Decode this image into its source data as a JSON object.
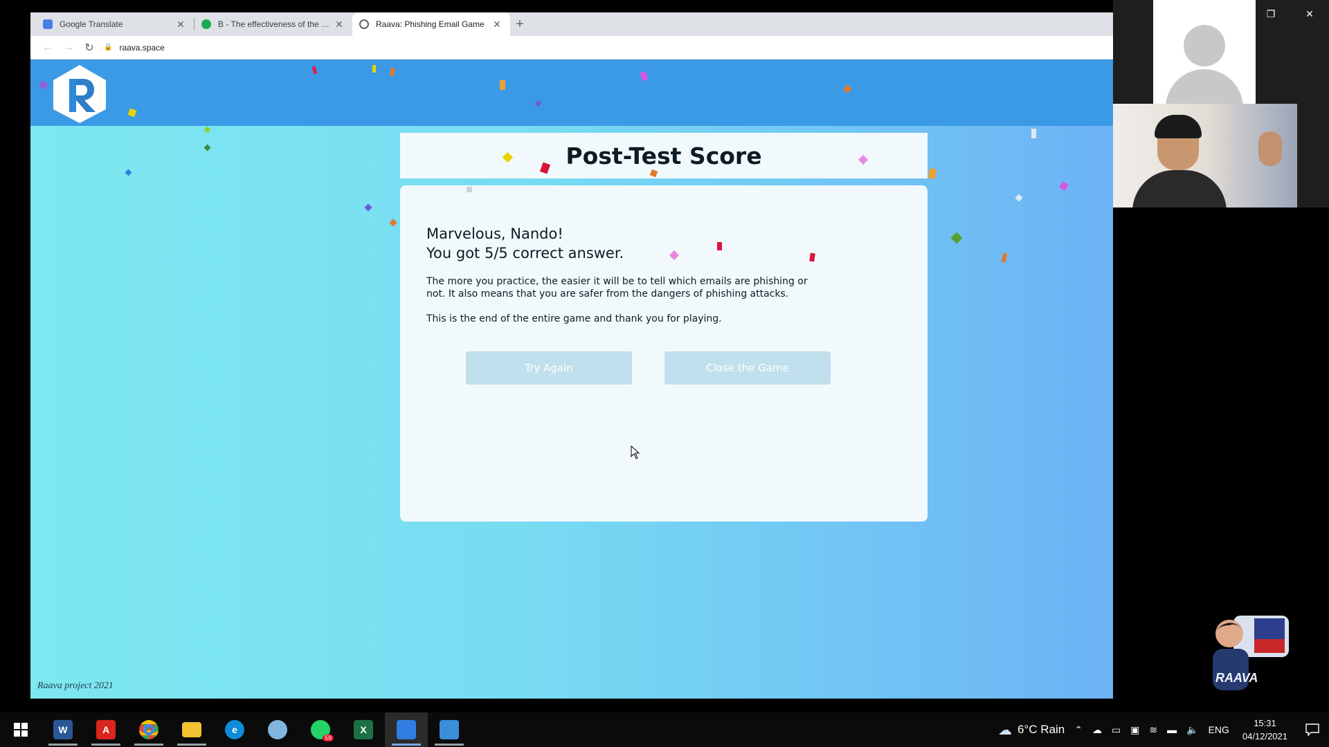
{
  "browser": {
    "tabs": [
      {
        "title": "Google Translate",
        "favicon_color": "#4a7de8"
      },
      {
        "title": "B - The effectiveness of the Phishi",
        "favicon_color": "#1eaa55"
      },
      {
        "title": "Raava: Phishing Email Game",
        "favicon_color": "#5f6368"
      }
    ],
    "new_tab": "+",
    "url": "raava.space"
  },
  "page": {
    "title": "Post-Test Score",
    "greeting_line1": "Marvelous, Nando!",
    "greeting_line2": "You got 5/5 correct answer.",
    "description": "The more you practice, the easier it will be to tell which emails are phishing or not. It also means that you are safer from the dangers of phishing attacks.",
    "closing": "This is the end of the entire game and thank you for playing.",
    "try_again_label": "Try Again",
    "close_game_label": "Close the Game",
    "footer": "Raava project 2021",
    "colors": {
      "header": "#3b9ae6",
      "button": "#bfe0ec",
      "card": "#f2f9fd"
    }
  },
  "taskbar": {
    "apps": [
      {
        "name": "word",
        "glyph": "W",
        "color": "#2b5797"
      },
      {
        "name": "acrobat",
        "glyph": "A",
        "color": "#d9251d"
      },
      {
        "name": "chrome",
        "glyph": "",
        "color": "#fbbc05"
      },
      {
        "name": "file-explorer",
        "glyph": "",
        "color": "#f1c232"
      },
      {
        "name": "edge",
        "glyph": "e",
        "color": "#0f8bd7"
      },
      {
        "name": "paint",
        "glyph": "",
        "color": "#7fb6e0"
      },
      {
        "name": "whatsapp",
        "glyph": "",
        "color": "#25d366",
        "badge": "59"
      },
      {
        "name": "excel",
        "glyph": "X",
        "color": "#1d7044"
      },
      {
        "name": "media-player",
        "glyph": "",
        "color": "#2f7de1"
      },
      {
        "name": "photos",
        "glyph": "",
        "color": "#3a8fd9"
      }
    ],
    "weather": "6°C  Rain",
    "language": "ENG",
    "time": "15:31",
    "date": "04/12/2021"
  }
}
